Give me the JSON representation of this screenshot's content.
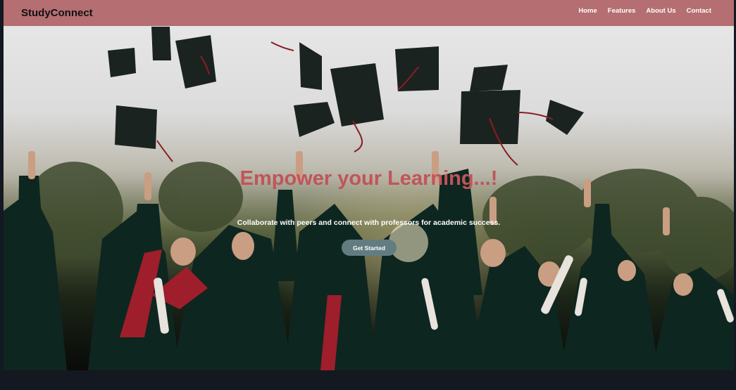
{
  "brand": {
    "name": "StudyConnect"
  },
  "nav": {
    "items": [
      {
        "label": "Home"
      },
      {
        "label": "Features"
      },
      {
        "label": "About Us"
      },
      {
        "label": "Contact"
      }
    ]
  },
  "hero": {
    "headline": "Empower your Learning...!",
    "subtitle": "Collaborate with peers and connect with professors for academic success.",
    "cta_label": "Get Started"
  },
  "colors": {
    "navbar": "#b06467",
    "headline": "#c0555a",
    "cta": "#637c82",
    "page_bg": "#141820"
  }
}
